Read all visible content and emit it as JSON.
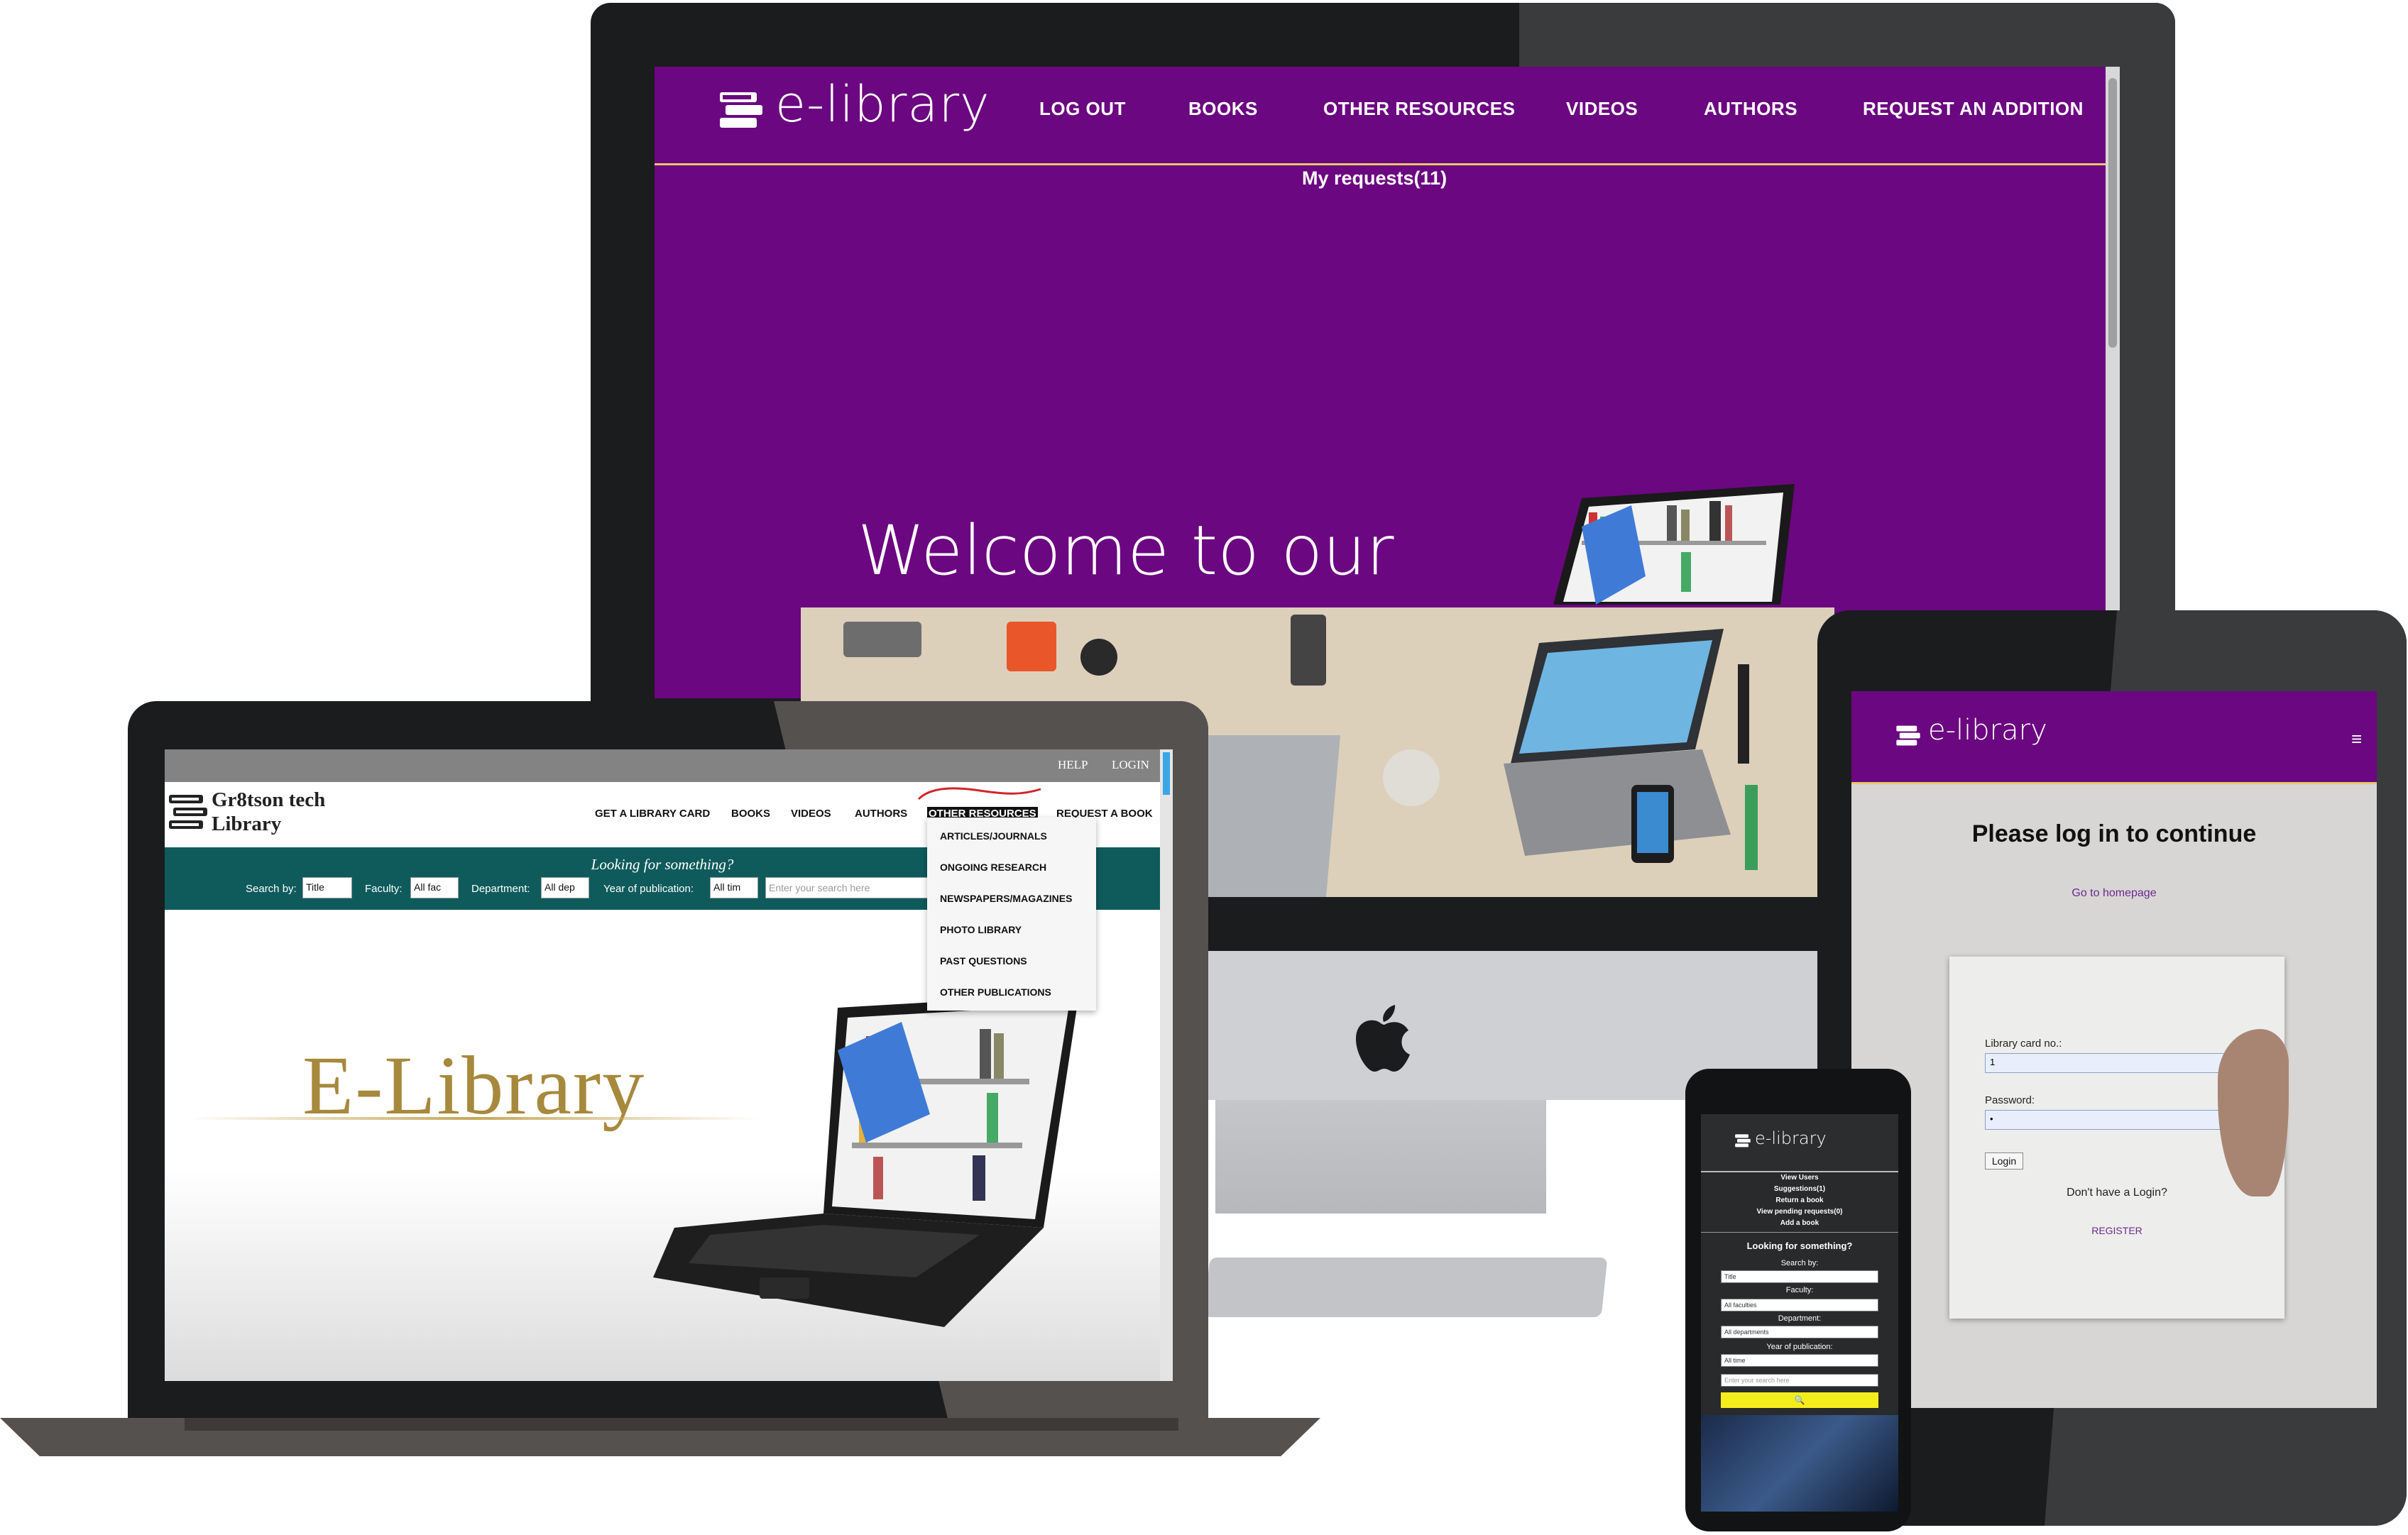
{
  "desktop": {
    "logo_text": "e-library",
    "nav": [
      "LOG OUT",
      "BOOKS",
      "OTHER RESOURCES",
      "VIDEOS",
      "AUTHORS",
      "REQUEST AN ADDITION"
    ],
    "my_requests": "My requests(11)",
    "welcome": "Welcome to our"
  },
  "tablet": {
    "logo_text": "e-library",
    "menu_icon": "≡",
    "title": "Please log in to continue",
    "home_link": "Go to homepage",
    "card_label": "Library card no.:",
    "card_value": "1",
    "password_label": "Password:",
    "password_value": "•",
    "login_button": "Login",
    "no_login": "Don't have a Login?",
    "register": "REGISTER"
  },
  "laptop": {
    "top_links": [
      "HELP",
      "LOGIN"
    ],
    "logo_line1": "Gr8tson tech",
    "logo_line2": "Library",
    "nav": [
      "GET A LIBRARY CARD",
      "BOOKS",
      "VIDEOS",
      "AUTHORS",
      "OTHER RESOURCES",
      "REQUEST A BOOK"
    ],
    "search_title": "Looking for something?",
    "search_by_label": "Search by:",
    "search_by_value": "Title",
    "faculty_label": "Faculty:",
    "faculty_value": "All fac",
    "department_label": "Department:",
    "department_value": "All dep",
    "year_label": "Year of publication:",
    "year_value": "All tim",
    "search_placeholder": "Enter your search here",
    "dropdown": [
      "ARTICLES/JOURNALS",
      "ONGOING RESEARCH",
      "NEWSPAPERS/MAGAZINES",
      "PHOTO LIBRARY",
      "PAST QUESTIONS",
      "OTHER PUBLICATIONS"
    ],
    "hero_title": "E-Library"
  },
  "phone": {
    "logo_text": "e-library",
    "menu": [
      "View Users",
      "Suggestions(1)",
      "Return a book",
      "View pending requests(0)",
      "Add a book"
    ],
    "look_title": "Looking for something?",
    "search_by_label": "Search by:",
    "search_by_value": "Title",
    "faculty_label": "Faculty:",
    "faculty_value": "All faculties",
    "department_label": "Department:",
    "department_value": "All departments",
    "year_label": "Year of publication:",
    "year_value": "All time",
    "search_placeholder": "Enter your search here",
    "search_button": "🔍"
  },
  "colors": {
    "brand_purple": "#6b0780",
    "accent_gold": "#e5c96a",
    "laptop_teal": "#0f5b5c",
    "search_yellow": "#f5ec1c"
  }
}
